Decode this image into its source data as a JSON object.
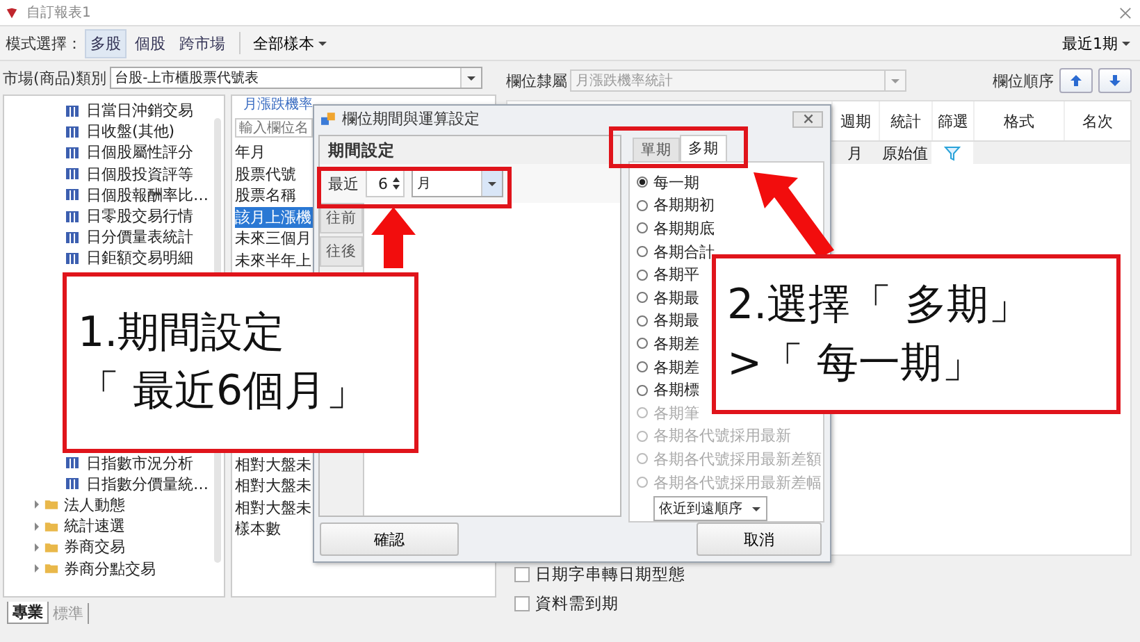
{
  "window": {
    "title": "自訂報表1"
  },
  "toolbar": {
    "mode_label": "模式選擇：",
    "modes": [
      {
        "label": "多股",
        "selected": true
      },
      {
        "label": "個股",
        "selected": false
      },
      {
        "label": "跨市場",
        "selected": false
      }
    ],
    "sample_menu": "全部樣本",
    "period_menu": "最近1期"
  },
  "market": {
    "label": "市場(商品)類別",
    "value": "台股-上市櫃股票代號表"
  },
  "tree": {
    "items_above": [
      {
        "label": "日當日沖銷交易",
        "kind": "table"
      },
      {
        "label": "日收盤(其他)",
        "kind": "table"
      },
      {
        "label": "日個股屬性評分",
        "kind": "table"
      },
      {
        "label": "日個股投資評等",
        "kind": "table"
      },
      {
        "label": "日個股報酬率比…",
        "kind": "table"
      },
      {
        "label": "日零股交易行情",
        "kind": "table"
      },
      {
        "label": "日分價量表統計",
        "kind": "table"
      },
      {
        "label": "日鉅額交易明細",
        "kind": "table"
      }
    ],
    "items_below": [
      {
        "label": "日指數市況分析",
        "kind": "table"
      },
      {
        "label": "日指數分價量統…",
        "kind": "table"
      },
      {
        "label": "法人動態",
        "kind": "folder"
      },
      {
        "label": "統計速選",
        "kind": "folder"
      },
      {
        "label": "券商交易",
        "kind": "folder"
      },
      {
        "label": "券商分點交易",
        "kind": "folder"
      }
    ]
  },
  "field_list": {
    "tab": "月漲跌機率",
    "placeholder": "輸入欄位名",
    "items_above": [
      {
        "label": "年月",
        "selected": false
      },
      {
        "label": "股票代號",
        "selected": false
      },
      {
        "label": "股票名稱",
        "selected": false
      },
      {
        "label": "該月上漲機",
        "selected": true
      },
      {
        "label": "未來三個月",
        "selected": false
      },
      {
        "label": "未來半年上",
        "selected": false
      }
    ],
    "items_below": [
      {
        "label": "相對大盤未",
        "selected": false
      },
      {
        "label": "相對大盤未",
        "selected": false
      },
      {
        "label": "相對大盤未",
        "selected": false
      },
      {
        "label": "樣本數",
        "selected": false
      }
    ]
  },
  "bottom_tabs": [
    {
      "label": "專業",
      "selected": true
    },
    {
      "label": "標準",
      "selected": false
    }
  ],
  "right": {
    "group_label": "欄位隸屬",
    "group_value": "月漲跌機率統計",
    "order_label": "欄位順序"
  },
  "table": {
    "columns": [
      "週期",
      "統計",
      "篩選",
      "格式",
      "名次"
    ],
    "row": {
      "period": "月",
      "stat": "原始值"
    }
  },
  "options": [
    {
      "label": "日期字串轉日期型態",
      "checked": false
    },
    {
      "label": "資料需到期",
      "checked": false
    }
  ],
  "dialog": {
    "title": "欄位期間與運算設定",
    "section": "期間設定",
    "recent_label": "最近",
    "count": "6",
    "unit": "月",
    "side_tabs": [
      "往前",
      "往後"
    ],
    "tabs": [
      {
        "label": "單期",
        "selected": false
      },
      {
        "label": "多期",
        "selected": true
      }
    ],
    "choices": [
      {
        "label": "每一期",
        "selected": true,
        "disabled": false
      },
      {
        "label": "各期期初",
        "selected": false,
        "disabled": false
      },
      {
        "label": "各期期底",
        "selected": false,
        "disabled": false
      },
      {
        "label": "各期合計",
        "selected": false,
        "disabled": false
      },
      {
        "label": "各期平",
        "selected": false,
        "disabled": false
      },
      {
        "label": "各期最",
        "selected": false,
        "disabled": false
      },
      {
        "label": "各期最",
        "selected": false,
        "disabled": false
      },
      {
        "label": "各期差",
        "selected": false,
        "disabled": false
      },
      {
        "label": "各期差",
        "selected": false,
        "disabled": false
      },
      {
        "label": "各期標",
        "selected": false,
        "disabled": false
      },
      {
        "label": "各期筆",
        "selected": false,
        "disabled": true
      },
      {
        "label": "各期各代號採用最新",
        "selected": false,
        "disabled": true
      },
      {
        "label": "各期各代號採用最新差額",
        "selected": false,
        "disabled": true
      },
      {
        "label": "各期各代號採用最新差幅",
        "selected": false,
        "disabled": true
      }
    ],
    "order": "依近到遠順序",
    "ok": "確認",
    "cancel": "取消"
  },
  "callouts": [
    {
      "lines": [
        "1.期間設定",
        "「 最近6個月」"
      ]
    },
    {
      "lines": [
        "2.選擇「 多期」",
        ">「 每一期」"
      ]
    }
  ]
}
